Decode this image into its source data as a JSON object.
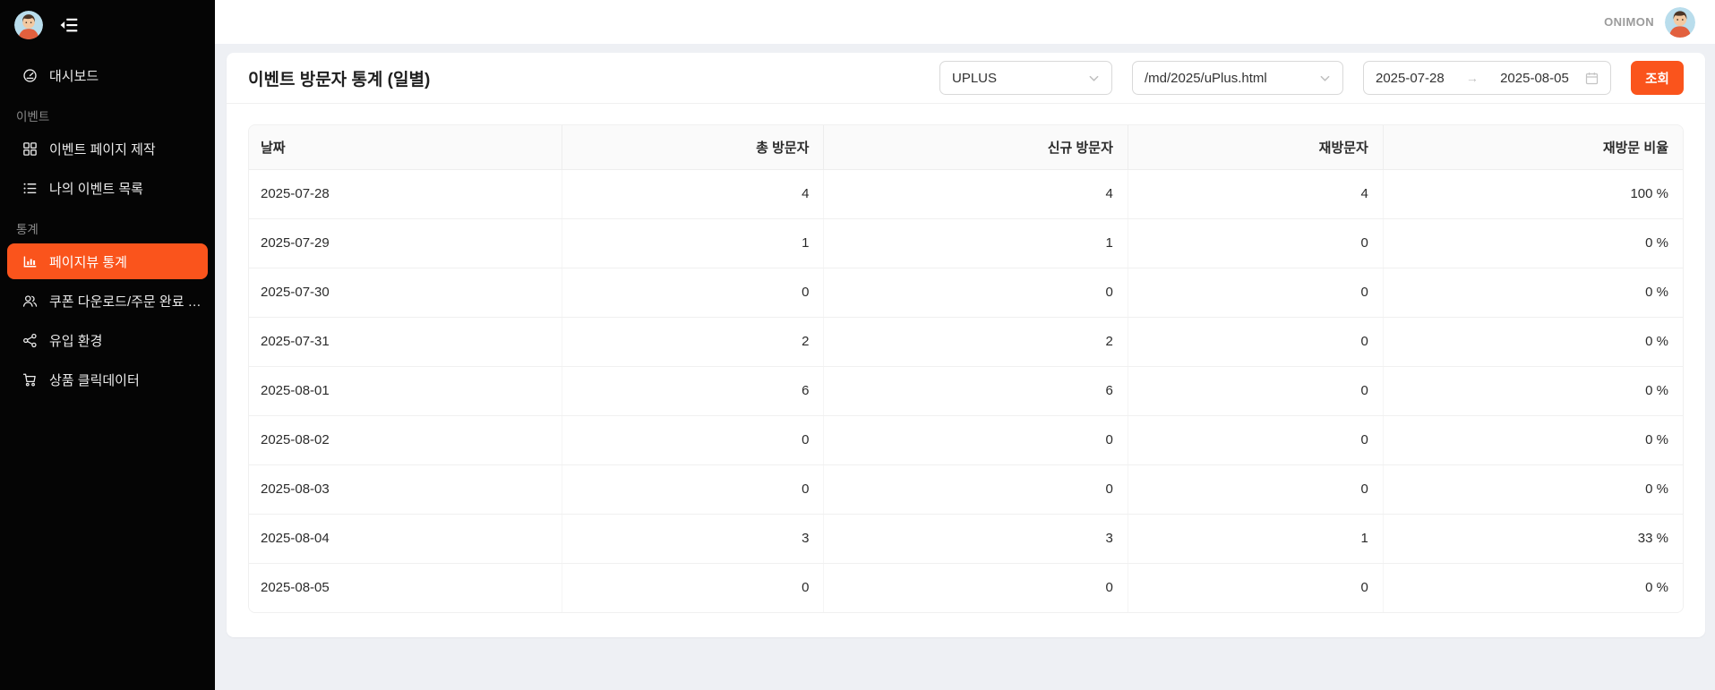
{
  "colors": {
    "accent": "#fa541c",
    "sidebar_bg": "#050505",
    "content_bg": "#eef0f4",
    "table_header_bg": "#fafafa"
  },
  "sidebar": {
    "items": [
      {
        "type": "link",
        "label": "대시보드",
        "icon": "dashboard-icon",
        "active": false
      },
      {
        "type": "section",
        "label": "이벤트"
      },
      {
        "type": "link",
        "label": "이벤트 페이지 제작",
        "icon": "appstore-icon",
        "active": false
      },
      {
        "type": "link",
        "label": "나의 이벤트 목록",
        "icon": "list-icon",
        "active": false
      },
      {
        "type": "section",
        "label": "통계"
      },
      {
        "type": "link",
        "label": "페이지뷰 통계",
        "icon": "bar-chart-icon",
        "active": true
      },
      {
        "type": "link",
        "label": "쿠폰 다운로드/주문 완료 …",
        "icon": "team-icon",
        "active": false
      },
      {
        "type": "link",
        "label": "유입 환경",
        "icon": "share-icon",
        "active": false
      },
      {
        "type": "link",
        "label": "상품 클릭데이터",
        "icon": "cart-icon",
        "active": false
      }
    ]
  },
  "topbar": {
    "username": "ONIMON"
  },
  "panel": {
    "title": "이벤트 방문자 통계 (일별)",
    "filters": {
      "event_select": "UPLUS",
      "page_select": "/md/2025/uPlus.html",
      "date_start": "2025-07-28",
      "date_end": "2025-08-05",
      "search_button": "조회"
    }
  },
  "table": {
    "columns": [
      "날짜",
      "총 방문자",
      "신규 방문자",
      "재방문자",
      "재방문 비율"
    ],
    "rows": [
      [
        "2025-07-28",
        "4",
        "4",
        "4",
        "100 %"
      ],
      [
        "2025-07-29",
        "1",
        "1",
        "0",
        "0 %"
      ],
      [
        "2025-07-30",
        "0",
        "0",
        "0",
        "0 %"
      ],
      [
        "2025-07-31",
        "2",
        "2",
        "0",
        "0 %"
      ],
      [
        "2025-08-01",
        "6",
        "6",
        "0",
        "0 %"
      ],
      [
        "2025-08-02",
        "0",
        "0",
        "0",
        "0 %"
      ],
      [
        "2025-08-03",
        "0",
        "0",
        "0",
        "0 %"
      ],
      [
        "2025-08-04",
        "3",
        "3",
        "1",
        "33 %"
      ],
      [
        "2025-08-05",
        "0",
        "0",
        "0",
        "0 %"
      ]
    ]
  }
}
